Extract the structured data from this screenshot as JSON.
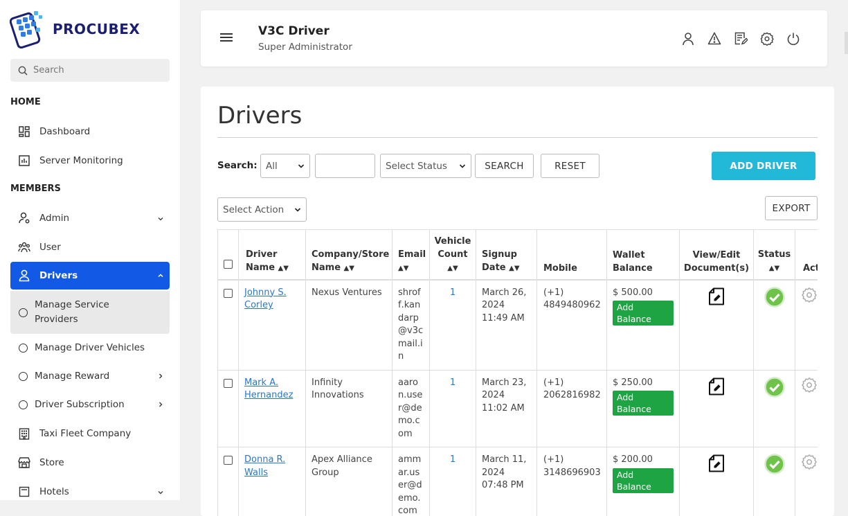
{
  "brand": {
    "name_part1": "PRO",
    "name_part2": "CUBEX"
  },
  "sidebar": {
    "search_placeholder": "Search",
    "sections": {
      "home": "HOME",
      "members": "MEMBERS"
    },
    "items": {
      "dashboard": "Dashboard",
      "server_monitoring": "Server Monitoring",
      "admin": "Admin",
      "user": "User",
      "drivers": "Drivers",
      "manage_service_providers": "Manage Service Providers",
      "manage_driver_vehicles": "Manage Driver Vehicles",
      "manage_reward": "Manage Reward",
      "driver_subscription": "Driver Subscription",
      "taxi_fleet_company": "Taxi Fleet Company",
      "store": "Store",
      "hotels": "Hotels"
    }
  },
  "header": {
    "title": "V3C Driver",
    "subtitle": "Super Administrator",
    "icons": [
      "user-icon",
      "warning-icon",
      "edit-note-icon",
      "settings-icon",
      "power-icon"
    ]
  },
  "main": {
    "title": "Drivers",
    "search_label": "Search:",
    "filter_selected": "All",
    "status_selected": "Select Status",
    "search_button": "SEARCH",
    "reset_button": "RESET",
    "add_button": "ADD DRIVER",
    "action_selected": "Select Action",
    "export_button": "EXPORT"
  },
  "table": {
    "headers": {
      "driver_name": "Driver Name",
      "company": "Company/Store Name",
      "email": "Email",
      "vehicle_count": "Vehicle Count",
      "signup_date": "Signup Date",
      "mobile": "Mobile",
      "wallet": "Wallet Balance",
      "documents": "View/Edit Document(s)",
      "status": "Status",
      "action": "Action"
    },
    "add_balance_label": "Add Balance",
    "rows": [
      {
        "name": "Johnny S. Corley",
        "company": "Nexus Ventures",
        "email": "shroff.kandarp@v3cmail.in",
        "vehicles": "1",
        "signup": "March 26, 2024 11:49 AM",
        "mobile": "(+1) 4849480962",
        "wallet": "$ 500.00"
      },
      {
        "name": "Mark A. Hernandez",
        "company": "Infinity Innovations",
        "email": "aaron.user@demo.com",
        "vehicles": "1",
        "signup": "March 23, 2024 11:02 AM",
        "mobile": "(+1) 2062816982",
        "wallet": "$ 250.00"
      },
      {
        "name": "Donna R. Walls",
        "company": "Apex Alliance Group",
        "email": "ammar.user@demo.com",
        "vehicles": "1",
        "signup": "March 11, 2024 07:48 PM",
        "mobile": "(+1) 3148696903",
        "wallet": "$ 200.00"
      }
    ]
  },
  "colors": {
    "primary": "#1259e6",
    "accent": "#22b8d8",
    "success": "#1fa443",
    "link": "#2a77c9"
  }
}
